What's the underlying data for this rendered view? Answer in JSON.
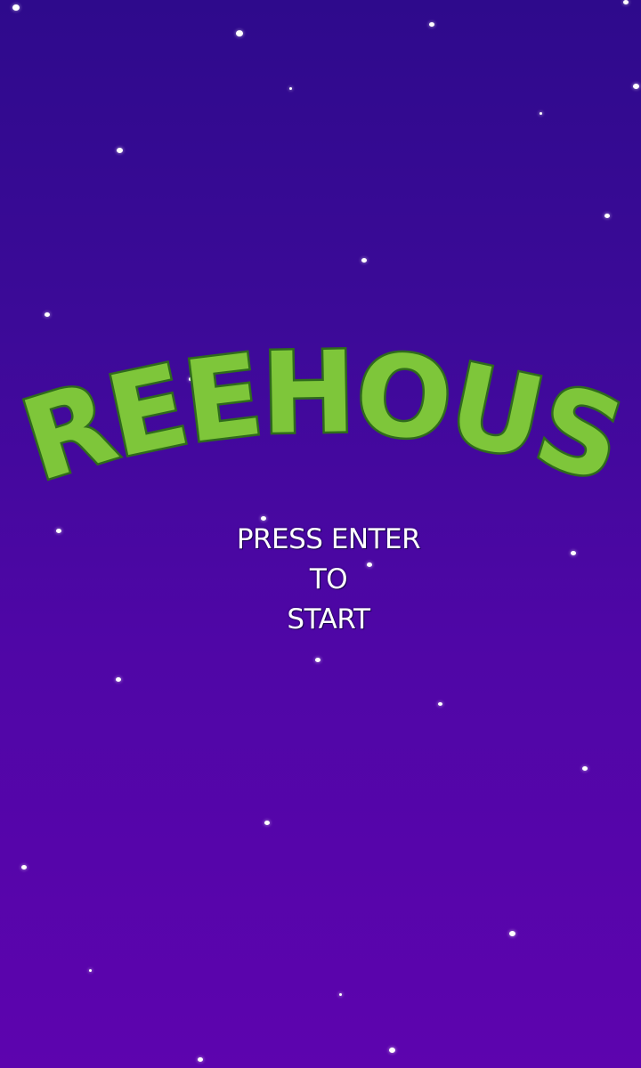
{
  "game": {
    "title": "TREEHOUSE",
    "prompt_lines": [
      "PRESS ENTER",
      "TO",
      "START"
    ]
  },
  "colors": {
    "background_top": "#2e0a8c",
    "background_bottom": "#5d04ae",
    "title_fill": "#7ec63a",
    "title_outline": "#2f6b1c",
    "prompt_text": "#ffffff",
    "stars": "#ffffff"
  },
  "stars_icon": "star-dot"
}
